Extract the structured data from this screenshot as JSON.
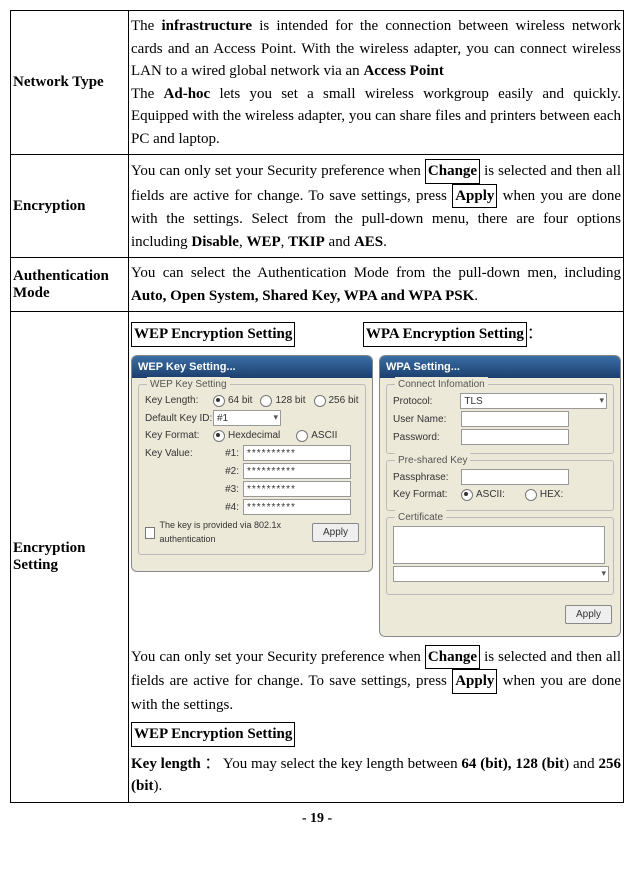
{
  "rows": {
    "network_type": {
      "label": "Network Type",
      "line1_pre": "The ",
      "line1_b1": "infrastructure",
      "line1_mid": " is intended for the connection between wireless network cards and an Access Point. With the wireless adapter, you can connect wireless LAN to a wired global network via an ",
      "line1_b2": "Access Point",
      "line2_pre": "The ",
      "line2_b1": "Ad-hoc",
      "line2_post": " lets you set a small wireless workgroup easily and quickly.   Equipped with the wireless adapter, you can share files and printers between each PC and laptop."
    },
    "encryption": {
      "label": "Encryption",
      "p_pre": "You can only set your Security preference when ",
      "p_box1": "Change",
      "p_mid1": " is selected and then all fields are active for change. To save settings, press ",
      "p_box2": "Apply",
      "p_mid2": " when you are done with the settings. Select from the pull-down menu, there are four options including ",
      "p_b1": "Disable",
      "p_c1": ", ",
      "p_b2": "WEP",
      "p_c2": ", ",
      "p_b3": "TKIP",
      "p_c3": " and ",
      "p_b4": "AES",
      "p_end": "."
    },
    "auth_mode": {
      "label": "Authentication Mode",
      "p_pre": "You can select the Authentication Mode from the pull-down men, including ",
      "p_b": "Auto, Open System, Shared Key, WPA and WPA PSK",
      "p_end": "."
    },
    "enc_setting": {
      "label": "Encryption Setting",
      "title_wep": "WEP Encryption Setting",
      "title_wpa": "WPA Encryption Setting",
      "colon": "：",
      "p2_pre": "You can only set your Security preference when ",
      "p2_box1": "Change",
      "p2_mid": " is selected and then all fields are active for change. To save settings, press ",
      "p2_box2": "Apply",
      "p2_end": " when you are done with the settings.",
      "title_wep2": "WEP Encryption Setting",
      "kl_b": "Key length",
      "kl_colon": " ： ",
      "kl_mid": "You may select the key length between ",
      "kl_b1": "64 (bit), 128 (bit",
      "kl_mid2": ") and ",
      "kl_b2": "256 (bit",
      "kl_end": ")."
    }
  },
  "wep_dialog": {
    "title": "WEP Key Setting...",
    "group": "WEP Key Setting",
    "key_length": "Key Length:",
    "r64": "64 bit",
    "r128": "128 bit",
    "r256": "256 bit",
    "default_key": "Default Key ID:",
    "default_key_val": "#1",
    "key_format": "Key Format:",
    "rhex": "Hexdecimal",
    "rascii": "ASCII",
    "key_value": "Key Value:",
    "k1": "#1:",
    "k2": "#2:",
    "k3": "#3:",
    "k4": "#4:",
    "mask": "**********",
    "checkbox_label": "The key is provided via 802.1x authentication",
    "apply": "Apply"
  },
  "wpa_dialog": {
    "title": "WPA Setting...",
    "group1": "Connect Infomation",
    "protocol": "Protocol:",
    "protocol_val": "TLS",
    "user": "User Name:",
    "pass": "Password:",
    "group2": "Pre-shared Key",
    "passphrase": "Passphrase:",
    "key_format": "Key Format:",
    "rascii": "ASCII:",
    "rhex": "HEX:",
    "group3": "Certificate",
    "apply": "Apply"
  },
  "page": "- 19 -"
}
